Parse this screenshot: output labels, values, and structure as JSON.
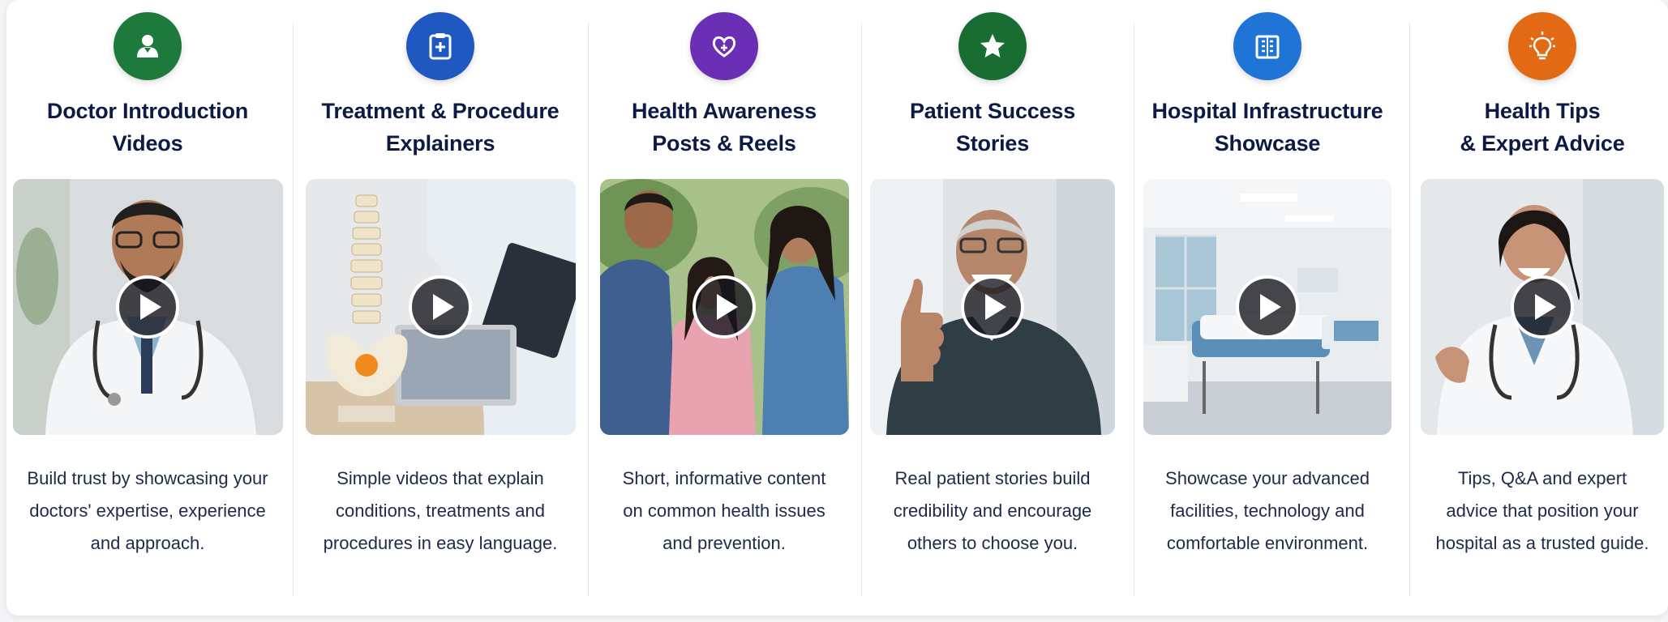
{
  "colors": {
    "green": "#1e7a3c",
    "blue": "#1e58c0",
    "purple": "#6a2fb5",
    "star_green": "#1a6d32",
    "sky": "#1f74d6",
    "orange": "#e36a14"
  },
  "cards": [
    {
      "icon": "doctor-avatar-icon",
      "title": "Doctor Introduction\nVideos",
      "description": "Build trust by showcasing your\ndoctors' expertise, experience\nand approach.",
      "image": "doctor-portrait-photo"
    },
    {
      "icon": "clipboard-medical-icon",
      "title": "Treatment & Procedure\nExplainers",
      "description": "Simple videos that explain\nconditions, treatments and\nprocedures in easy language.",
      "image": "spine-model-photo"
    },
    {
      "icon": "heart-hands-icon",
      "title": "Health Awareness\nPosts & Reels",
      "description": "Short, informative content\non common health issues\nand prevention.",
      "image": "family-photo"
    },
    {
      "icon": "star-icon",
      "title": "Patient Success\nStories",
      "description": "Real patient stories build\ncredibility and encourage\nothers to choose you.",
      "image": "happy-patient-photo"
    },
    {
      "icon": "hospital-building-icon",
      "title": "Hospital Infrastructure\nShowcase",
      "description": "Showcase your advanced\nfacilities, technology and\ncomfortable environment.",
      "image": "hospital-ward-photo"
    },
    {
      "icon": "lightbulb-icon",
      "title": "Health Tips\n& Expert Advice",
      "description": "Tips, Q&A and expert\nadvice that position your\nhospital as a trusted guide.",
      "image": "female-doctor-photo"
    }
  ]
}
